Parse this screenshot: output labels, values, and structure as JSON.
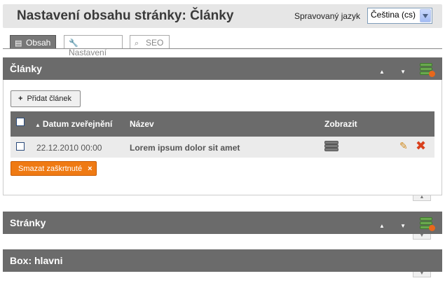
{
  "header": {
    "title": "Nastavení obsahu stránky: Články",
    "language_label": "Spravovaný jazyk",
    "language_selected": "Čeština (cs)"
  },
  "tabs": [
    {
      "label": "Obsah",
      "icon": "document-icon",
      "active": true
    },
    {
      "label": "Nastavení",
      "icon": "wrench-icon",
      "active": false
    },
    {
      "label": "SEO",
      "icon": "magnifier-icon",
      "active": false
    }
  ],
  "panels": {
    "articles": {
      "title": "Články",
      "add_button": "Přidat článek",
      "columns": [
        "Datum zveřejnění",
        "Název",
        "Zobrazit"
      ],
      "rows": [
        {
          "date": "22.12.2010 00:00",
          "name": "Lorem ipsum dolor sit amet"
        }
      ],
      "delete_checked": "Smazat zaškrtnuté",
      "delete_mark": "×"
    },
    "pages": {
      "title": "Stránky"
    },
    "box": {
      "title": "Box: hlavni"
    }
  },
  "glyphs": {
    "sort_asc": "▲",
    "up_down": "▲ ▼",
    "plus": "+",
    "edit": "✎",
    "delete": "✖",
    "collapse": "▲",
    "expand": "▼"
  },
  "colors": {
    "panel_header": "#6b6b6b",
    "danger_button": "#ef7a13",
    "accent_green": "#6aa84f"
  }
}
